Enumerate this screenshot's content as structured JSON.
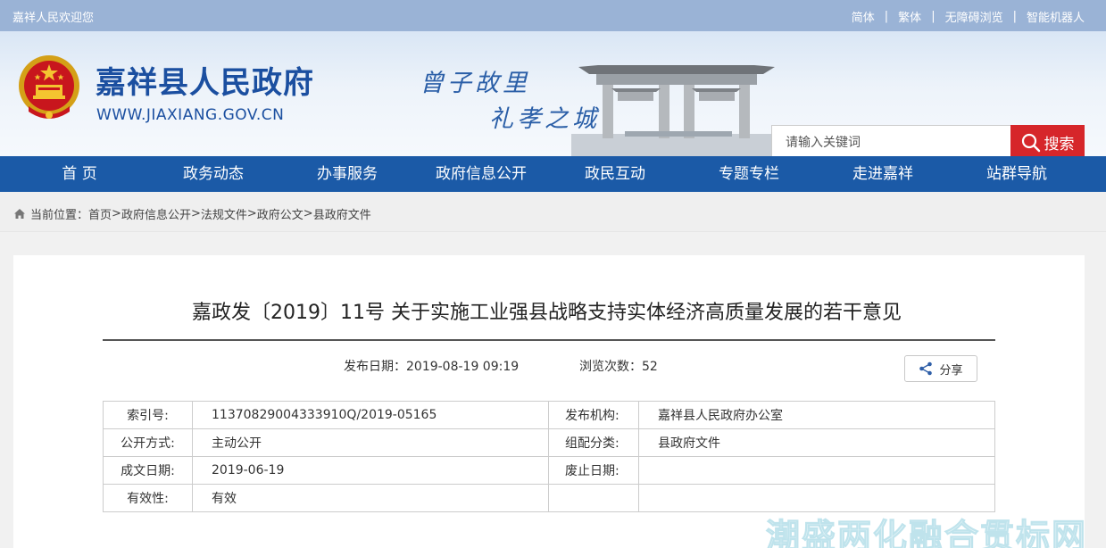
{
  "topbar": {
    "welcome": "嘉祥人民欢迎您",
    "links": [
      "简体",
      "繁体",
      "无障碍浏览",
      "智能机器人"
    ],
    "separator": "|"
  },
  "header": {
    "site_name": "嘉祥县人民政府",
    "site_url": "WWW.JIAXIANG.GOV.CN",
    "slogan_line1": "曾子故里",
    "slogan_line2": "礼孝之城",
    "search_placeholder": "请输入关键词",
    "search_button": "搜索"
  },
  "nav": {
    "items": [
      "首 页",
      "政务动态",
      "办事服务",
      "政府信息公开",
      "政民互动",
      "专题专栏",
      "走进嘉祥",
      "站群导航"
    ]
  },
  "breadcrumb": {
    "prefix": "当前位置：",
    "items": [
      "首页",
      "政府信息公开",
      "法规文件",
      "政府公文",
      "县政府文件"
    ],
    "separator": ">"
  },
  "document": {
    "title": "嘉政发〔2019〕11号 关于实施工业强县战略支持实体经济高质量发展的若干意见",
    "publish_date_label": "发布日期：",
    "publish_date": "2019-08-19 09:19",
    "views_label": "浏览次数：",
    "views": "52",
    "share_label": "分享"
  },
  "info_table": {
    "rows": [
      {
        "k1": "索引号:",
        "v1": "11370829004333910Q/2019-05165",
        "k2": "发布机构:",
        "v2": "嘉祥县人民政府办公室"
      },
      {
        "k1": "公开方式:",
        "v1": "主动公开",
        "k2": "组配分类:",
        "v2": "县政府文件"
      },
      {
        "k1": "成文日期:",
        "v1": "2019-06-19",
        "k2": "废止日期:",
        "v2": ""
      },
      {
        "k1": "有效性:",
        "v1": "有效",
        "k2": "",
        "v2": ""
      }
    ]
  },
  "watermark": "潮盛两化融合贯标网",
  "colors": {
    "topbar_bg": "#9ab3d6",
    "nav_bg": "#1b5aa7",
    "brand_blue": "#1b4fa0",
    "search_button_bg": "#d6262a"
  }
}
